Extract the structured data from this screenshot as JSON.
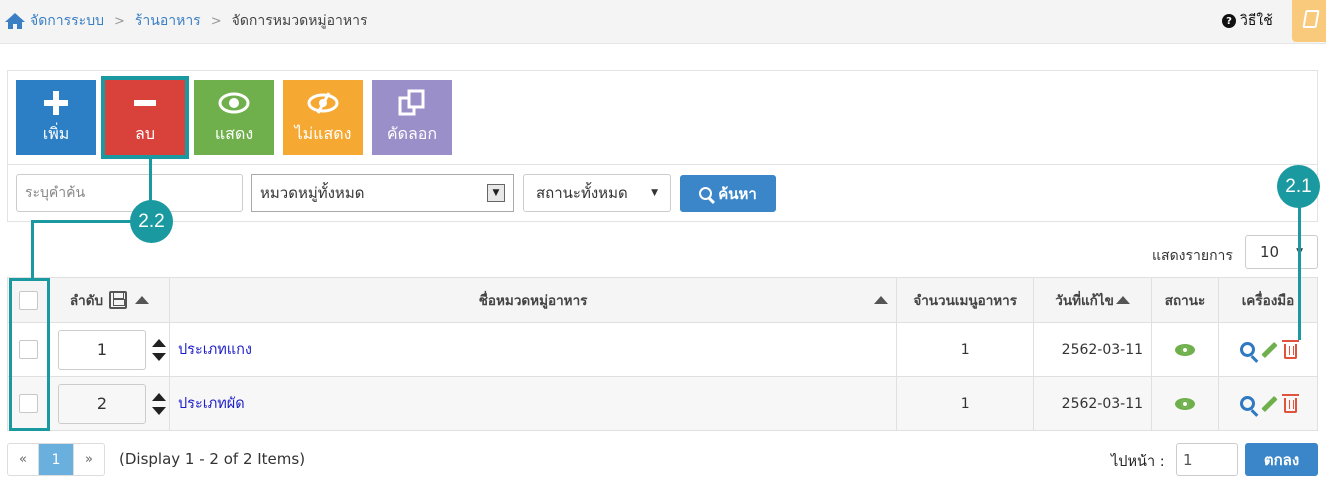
{
  "breadcrumb": {
    "home": "จัดการระบบ",
    "level2": "ร้านอาหาร",
    "current": "จัดการหมวดหมู่อาหาร",
    "sep": ">"
  },
  "help": {
    "label": "วิธีใช้"
  },
  "toolbar": {
    "add": "เพิ่ม",
    "delete": "ลบ",
    "show": "แสดง",
    "hide": "ไม่แสดง",
    "copy": "คัดลอก"
  },
  "filters": {
    "search_placeholder": "ระบุคำค้น",
    "category": "หมวดหมู่ทั้งหมด",
    "status": "สถานะทั้งหมด",
    "search_button": "ค้นหา"
  },
  "per_page": {
    "label": "แสดงรายการ",
    "value": "10"
  },
  "table": {
    "columns": {
      "order": "ลำดับ",
      "name": "ชื่อหมวดหมู่อาหาร",
      "menu_count": "จำนวนเมนูอาหาร",
      "modified": "วันที่แก้ไข",
      "status": "สถานะ",
      "tools": "เครื่องมือ"
    },
    "rows": [
      {
        "order": "1",
        "name": "ประเภทแกง",
        "menu_count": "1",
        "modified": "2562-03-11"
      },
      {
        "order": "2",
        "name": "ประเภทผัด",
        "menu_count": "1",
        "modified": "2562-03-11"
      }
    ]
  },
  "pagination": {
    "prev": "«",
    "page": "1",
    "next": "»",
    "display": "(Display 1 - 2 of 2 Items)",
    "goto_label": "ไปหน้า :",
    "goto_value": "1",
    "ok": "ตกลง"
  },
  "annotations": {
    "a1": "2.1",
    "a2": "2.2"
  },
  "colors": {
    "accent": "#3a86c8",
    "annotation": "#1a9aa0",
    "add": "#2c7fc5",
    "delete": "#d9413b",
    "show": "#6fb04c",
    "hide": "#f5a932",
    "copy": "#9b8fc9"
  }
}
